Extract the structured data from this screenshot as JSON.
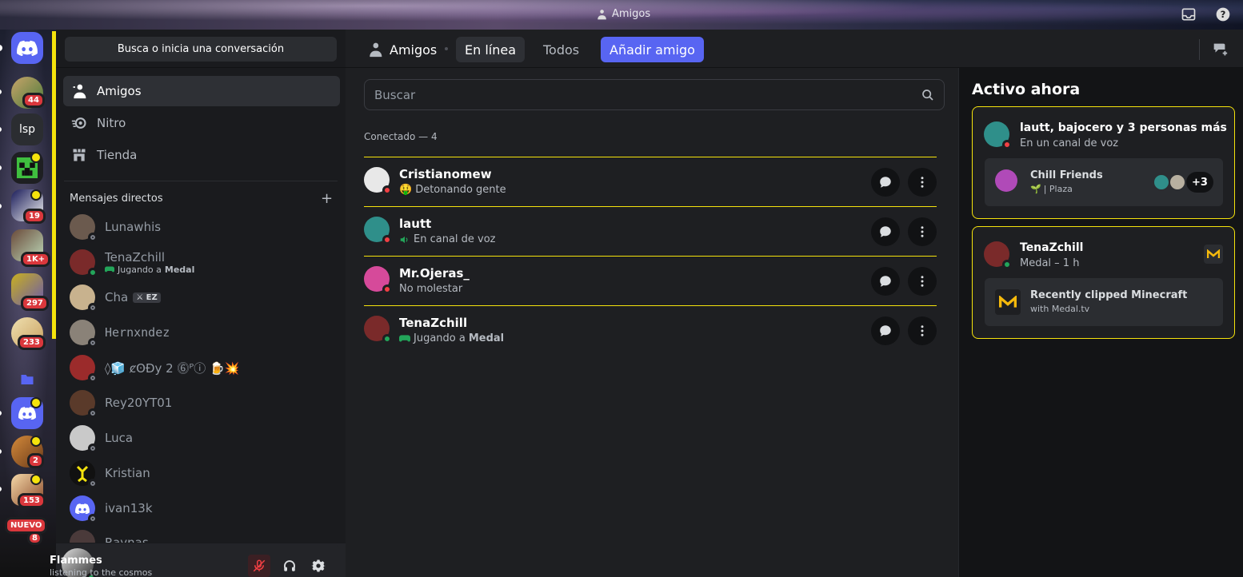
{
  "window": {
    "title": "Amigos"
  },
  "rail": {
    "badges": [
      "44",
      "19",
      "1K+",
      "297",
      "233",
      "2",
      "153",
      "8"
    ],
    "new_label": "NUEVO",
    "text_server": "lsp"
  },
  "sidebar": {
    "search_label": "Busca o inicia una conversación",
    "nav": [
      {
        "label": "Amigos",
        "icon": "friends-icon"
      },
      {
        "label": "Nitro",
        "icon": "nitro-icon"
      },
      {
        "label": "Tienda",
        "icon": "shop-icon"
      }
    ],
    "dm_header": "Mensajes directos",
    "dms": [
      {
        "name": "Lunawhis",
        "sub": "",
        "status": "offline",
        "color": "#6b5a4e"
      },
      {
        "name": "TenaZchill",
        "sub_prefix": "Jugando a ",
        "sub_game": "Medal",
        "status": "online",
        "color": "#7a2a2a"
      },
      {
        "name": "Cha",
        "tag": "EZ",
        "status": "offline",
        "color": "#c8b28e"
      },
      {
        "name": "Hernxndez",
        "status": "offline",
        "color": "#8a8278"
      },
      {
        "name": "◊🧊 ȼʘĐy 2 ⓺ᴾⓘ 🍺💥",
        "status": "offline",
        "color": "#9b2b2b"
      },
      {
        "name": "Rey20YT01",
        "status": "offline",
        "color": "#5a3a2a"
      },
      {
        "name": "Luca",
        "status": "offline",
        "color": "#c9c9c9"
      },
      {
        "name": "Kristian",
        "status": "offline",
        "color": "#f5e30c"
      },
      {
        "name": "ivan13k",
        "status": "offline",
        "color": "#5865f2"
      },
      {
        "name": "Raynas",
        "status": "offline",
        "color": "#4a3a3a"
      }
    ],
    "user": {
      "name": "Flammes",
      "status_text": "listening to the cosmos"
    }
  },
  "topbar": {
    "title": "Amigos",
    "tabs": [
      "En línea",
      "Todos"
    ],
    "add_friend": "Añadir amigo"
  },
  "main": {
    "search_placeholder": "Buscar",
    "section_title": "Conectado — 4",
    "friends": [
      {
        "name": "Cristianomew",
        "status_emoji": "🤑",
        "status_text": "Detonando gente",
        "status": "dnd",
        "color": "#e8e8e8"
      },
      {
        "name": "lautt",
        "status_text": "En canal de voz",
        "status_kind": "voice",
        "status": "dnd",
        "color": "#2f8f8a"
      },
      {
        "name": "Mr.Ojeras_",
        "status_text": "No molestar",
        "status": "dnd",
        "color": "#d64a9a"
      },
      {
        "name": "TenaZchill",
        "status_text_prefix": "Jugando a ",
        "status_game": "Medal",
        "status_kind": "game",
        "status": "online",
        "color": "#7a2a2a"
      }
    ]
  },
  "active_now": {
    "title": "Activo ahora",
    "cards": [
      {
        "title": "lautt, bajocero y 3 personas más",
        "subtitle": "En un canal de voz",
        "inner_title": "Chill Friends",
        "inner_sub": "| Plaza",
        "extra_count": "+3"
      },
      {
        "title": "TenaZchill",
        "subtitle": "Medal – 1 h",
        "inner_title": "Recently clipped Minecraft",
        "inner_sub": "with Medal.tv"
      }
    ]
  },
  "colors": {
    "accent": "#5865f2",
    "highlight": "#f5e30c",
    "online": "#23a55a",
    "dnd": "#f23f43"
  }
}
